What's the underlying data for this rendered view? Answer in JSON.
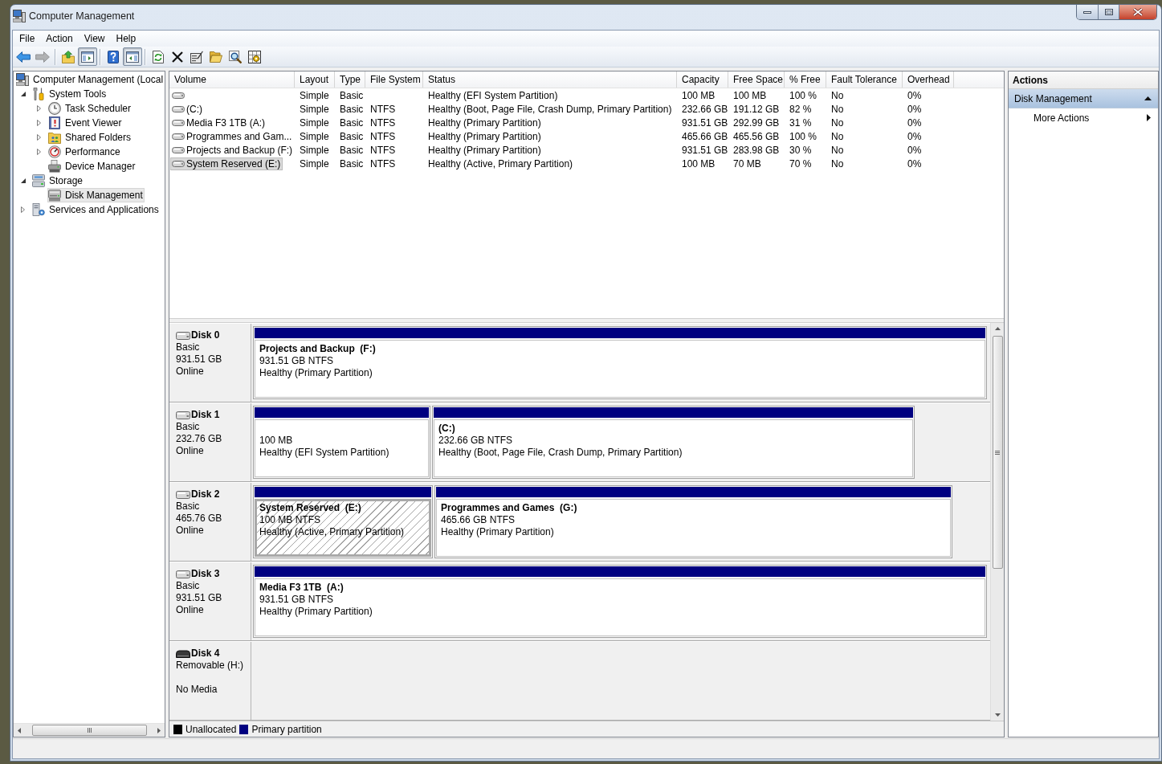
{
  "window": {
    "title": "Computer Management"
  },
  "menu": [
    "File",
    "Action",
    "View",
    "Help"
  ],
  "toolbar": {
    "groups": [
      {
        "buttons": [
          {
            "kind": "back",
            "pressed": false,
            "disabled": false
          },
          {
            "kind": "forward",
            "pressed": false,
            "disabled": true
          }
        ]
      },
      {
        "buttons": [
          {
            "kind": "up",
            "pressed": false,
            "disabled": false
          },
          {
            "kind": "console-tree",
            "pressed": true,
            "disabled": false
          }
        ]
      },
      {
        "buttons": [
          {
            "kind": "help",
            "pressed": false,
            "disabled": false
          },
          {
            "kind": "action-pane",
            "pressed": true,
            "disabled": false
          }
        ]
      },
      {
        "buttons": [
          {
            "kind": "refresh",
            "pressed": false,
            "disabled": false
          },
          {
            "kind": "delete",
            "pressed": false,
            "disabled": false
          },
          {
            "kind": "properties",
            "pressed": false,
            "disabled": false
          },
          {
            "kind": "open",
            "pressed": false,
            "disabled": false
          },
          {
            "kind": "search",
            "pressed": false,
            "disabled": false
          },
          {
            "kind": "settings",
            "pressed": false,
            "disabled": false
          }
        ]
      }
    ]
  },
  "tree": [
    {
      "label": "Computer Management (Local",
      "kind": "computer",
      "selected": false,
      "children": [
        {
          "label": "System Tools",
          "kind": "tools",
          "selected": false,
          "expanded": true,
          "children": [
            {
              "label": "Task Scheduler",
              "kind": "clock",
              "selected": false,
              "expanded": false
            },
            {
              "label": "Event Viewer",
              "kind": "log",
              "selected": false,
              "expanded": false
            },
            {
              "label": "Shared Folders",
              "kind": "share",
              "selected": false,
              "expanded": false
            },
            {
              "label": "Performance",
              "kind": "performance",
              "selected": false,
              "expanded": false
            },
            {
              "label": "Device Manager",
              "kind": "devices",
              "selected": false
            }
          ]
        },
        {
          "label": "Storage",
          "kind": "storage",
          "selected": false,
          "expanded": true,
          "children": [
            {
              "label": "Disk Management",
              "kind": "disk",
              "selected": true
            }
          ]
        },
        {
          "label": "Services and Applications",
          "kind": "services",
          "selected": false,
          "expanded": false
        }
      ]
    }
  ],
  "table": {
    "columns": [
      "Volume",
      "Layout",
      "Type",
      "File System",
      "Status",
      "Capacity",
      "Free Space",
      "% Free",
      "Fault Tolerance",
      "Overhead"
    ],
    "rows": [
      {
        "layout": "Simple",
        "type": "Basic",
        "status": "Healthy (EFI System Partition)",
        "capacity": "100 MB",
        "free_space": "100 MB",
        "percent_free": "100 %",
        "fault_tolerance": "No",
        "overhead": "0%",
        "selected": false
      },
      {
        "volume": "(C:)",
        "layout": "Simple",
        "type": "Basic",
        "file_system": "NTFS",
        "status": "Healthy (Boot, Page File, Crash Dump, Primary Partition)",
        "capacity": "232.66 GB",
        "free_space": "191.12 GB",
        "percent_free": "82 %",
        "fault_tolerance": "No",
        "overhead": "0%",
        "selected": false
      },
      {
        "volume": "Media F3 1TB (A:)",
        "layout": "Simple",
        "type": "Basic",
        "file_system": "NTFS",
        "status": "Healthy (Primary Partition)",
        "capacity": "931.51 GB",
        "free_space": "292.99 GB",
        "percent_free": "31 %",
        "fault_tolerance": "No",
        "overhead": "0%",
        "selected": false
      },
      {
        "volume": "Programmes and Gam...",
        "layout": "Simple",
        "type": "Basic",
        "file_system": "NTFS",
        "status": "Healthy (Primary Partition)",
        "capacity": "465.66 GB",
        "free_space": "465.56 GB",
        "percent_free": "100 %",
        "fault_tolerance": "No",
        "overhead": "0%",
        "selected": false
      },
      {
        "volume": "Projects and Backup (F:)",
        "layout": "Simple",
        "type": "Basic",
        "file_system": "NTFS",
        "status": "Healthy (Primary Partition)",
        "capacity": "931.51 GB",
        "free_space": "283.98 GB",
        "percent_free": "30 %",
        "fault_tolerance": "No",
        "overhead": "0%",
        "selected": false
      },
      {
        "volume": "System Reserved (E:)",
        "layout": "Simple",
        "type": "Basic",
        "file_system": "NTFS",
        "status": "Healthy (Active, Primary Partition)",
        "capacity": "100 MB",
        "free_space": "70 MB",
        "percent_free": "70 %",
        "fault_tolerance": "No",
        "overhead": "0%",
        "selected": true
      }
    ]
  },
  "disks": [
    {
      "name": "Disk 0",
      "kind": "basic",
      "type": "Basic",
      "size": "931.51 GB",
      "status": "Online",
      "partitions": [
        {
          "name": "Projects and Backup  (F:)",
          "size": "931.51 GB NTFS",
          "status": "Healthy (Primary Partition)",
          "selected": false
        }
      ]
    },
    {
      "name": "Disk 1",
      "kind": "basic",
      "type": "Basic",
      "size": "232.76 GB",
      "status": "Online",
      "partitions": [
        {
          "size": "100 MB",
          "status": "Healthy (EFI System Partition)",
          "selected": false
        },
        {
          "name": "(C:)",
          "size": "232.66 GB NTFS",
          "status": "Healthy (Boot, Page File, Crash Dump, Primary Partition)",
          "selected": false
        }
      ]
    },
    {
      "name": "Disk 2",
      "kind": "basic",
      "type": "Basic",
      "size": "465.76 GB",
      "status": "Online",
      "partitions": [
        {
          "name": "System Reserved  (E:)",
          "size": "100 MB NTFS",
          "status": "Healthy (Active, Primary Partition)",
          "selected": true
        },
        {
          "name": "Programmes and Games  (G:)",
          "size": "465.66 GB NTFS",
          "status": "Healthy (Primary Partition)",
          "selected": false
        }
      ]
    },
    {
      "name": "Disk 3",
      "kind": "basic",
      "type": "Basic",
      "size": "931.51 GB",
      "status": "Online",
      "partitions": [
        {
          "name": "Media F3 1TB  (A:)",
          "size": "931.51 GB NTFS",
          "status": "Healthy (Primary Partition)",
          "selected": false
        }
      ]
    },
    {
      "name": "Disk 4",
      "kind": "removable",
      "type": "Removable (H:)",
      "status": "No Media"
    }
  ],
  "legend": [
    {
      "label": "Unallocated",
      "color": "#000000"
    },
    {
      "label": "Primary partition",
      "color": "#000080"
    }
  ],
  "actions": {
    "title": "Actions",
    "sections": [
      {
        "label": "Disk Management",
        "expanded": true,
        "items": [
          {
            "label": "More Actions",
            "submenu": true
          }
        ]
      }
    ]
  }
}
